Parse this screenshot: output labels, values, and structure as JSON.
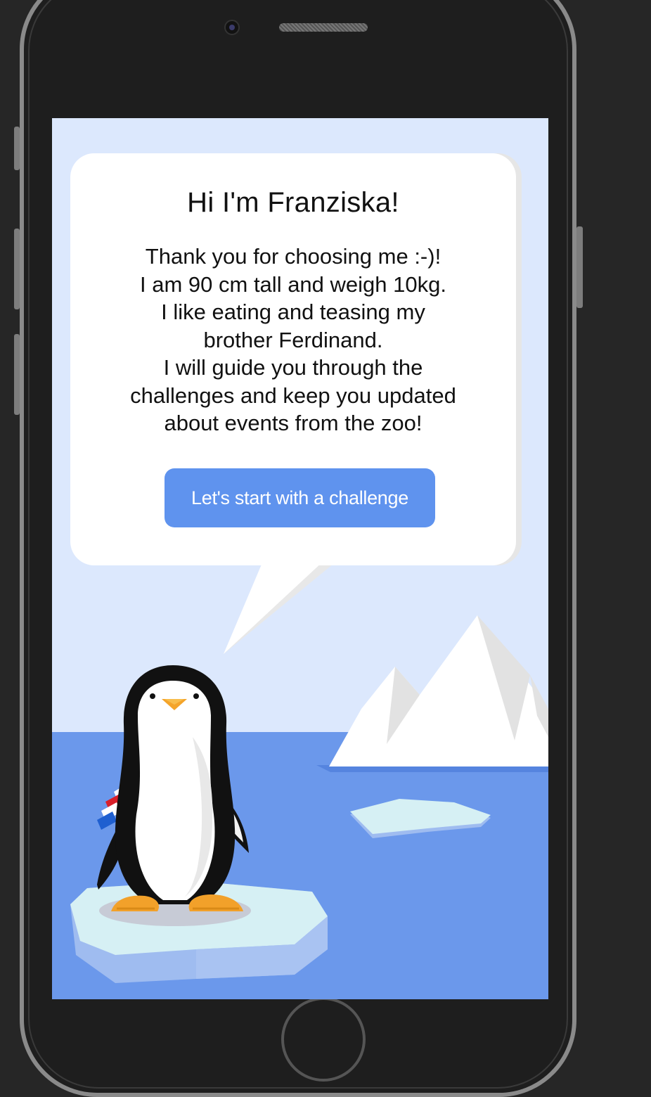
{
  "greeting": {
    "title": "Hi I'm Franziska!",
    "message": "Thank you for choosing me :-)!\nI am 90 cm tall and weigh 10kg.\nI like eating and teasing my\nbrother Ferdinand.\nI will guide you through the\nchallenges and keep you updated\nabout events from the zoo!",
    "button_label": "Let's start with a challenge"
  },
  "colors": {
    "sky": "#dce8fd",
    "water": "#6b98eb",
    "button": "#5f93ee",
    "ice": "#d6f0f4"
  }
}
